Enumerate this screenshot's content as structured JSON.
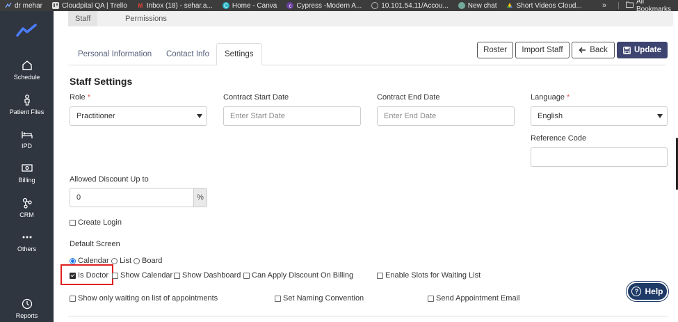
{
  "bookmarks": {
    "items": [
      {
        "label": "dr mehar",
        "icon": "bookmark-icon"
      },
      {
        "label": "Cloudpital QA | Trello",
        "icon": "trello-icon"
      },
      {
        "label": "Inbox (18) - sehar.a...",
        "icon": "gmail-icon"
      },
      {
        "label": "Home - Canva",
        "icon": "canva-icon"
      },
      {
        "label": "Cypress -Modern A...",
        "icon": "cypress-icon"
      },
      {
        "label": "10.101.54.11/Accou...",
        "icon": "globe-icon"
      },
      {
        "label": "New chat",
        "icon": "chatgpt-icon"
      },
      {
        "label": "Short Videos Cloud...",
        "icon": "drive-icon"
      }
    ],
    "more": "»",
    "all_label": "All Bookmarks"
  },
  "sidebar": {
    "items": [
      {
        "label": "Schedule",
        "icon": "home-icon"
      },
      {
        "label": "Patient Files",
        "icon": "person-icon"
      },
      {
        "label": "IPD",
        "icon": "bed-icon"
      },
      {
        "label": "Billing",
        "icon": "money-icon"
      },
      {
        "label": "CRM",
        "icon": "network-icon"
      },
      {
        "label": "Others",
        "icon": "more-dots-icon"
      },
      {
        "label": "Reports",
        "icon": "clock-icon"
      }
    ]
  },
  "top_tabs": {
    "staff": "Staff",
    "permissions": "Permissions"
  },
  "sub_tabs": {
    "personal": "Personal Information",
    "contact": "Contact Info",
    "settings": "Settings"
  },
  "toolbar": {
    "roster": "Roster",
    "import_staff": "Import Staff",
    "back": "Back",
    "update": "Update"
  },
  "form": {
    "title": "Staff Settings",
    "role_label": "Role",
    "required_mark": "*",
    "role_value": "Practitioner",
    "contract_start_label": "Contract Start Date",
    "contract_start_placeholder": "Enter Start Date",
    "contract_end_label": "Contract End Date",
    "contract_end_placeholder": "Enter End Date",
    "language_label": "Language",
    "language_value": "English",
    "reference_code_label": "Reference Code",
    "reference_code_value": "",
    "discount_label": "Allowed Discount Up to",
    "discount_value": "0",
    "discount_unit": "%",
    "create_login": "Create Login",
    "default_screen_label": "Default Screen",
    "default_screen_options": [
      "Calendar",
      "List",
      "Board"
    ],
    "default_screen_selected": "Calendar",
    "checkboxes": {
      "is_doctor": "Is Doctor",
      "show_calendar": "Show Calendar",
      "show_dashboard": "Show Dashboard",
      "can_apply_discount": "Can Apply Discount On Billing",
      "enable_slots": "Enable Slots for Waiting List",
      "show_only_waiting": "Show only waiting on list of appointments",
      "set_naming": "Set Naming Convention",
      "send_email": "Send Appointment Email"
    },
    "is_doctor_checked": true
  },
  "help": {
    "label": "Help"
  },
  "colors": {
    "sidebar": "#2f3640",
    "primary": "#3d4470",
    "highlight": "#e02020",
    "help": "#1e3a66"
  }
}
